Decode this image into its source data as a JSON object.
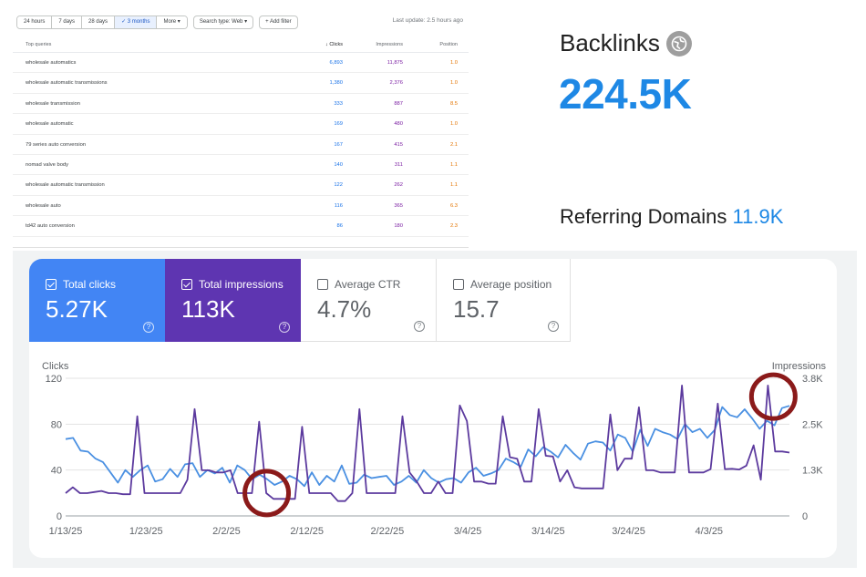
{
  "query_table": {
    "filters": {
      "ranges": [
        "24 hours",
        "7 days",
        "28 days",
        "3 months",
        "More"
      ],
      "active_range": "3 months",
      "search_type": "Search type: Web",
      "add_filter": "Add filter"
    },
    "last_update": "Last update: 2.5 hours ago",
    "headers": {
      "query": "Top queries",
      "clicks": "Clicks",
      "impressions": "Impressions",
      "position": "Position"
    },
    "rows": [
      {
        "query": "wholesale automatics",
        "clicks": "6,893",
        "impressions": "11,875",
        "position": "1.0"
      },
      {
        "query": "wholesale automatic transmissions",
        "clicks": "1,380",
        "impressions": "2,376",
        "position": "1.0"
      },
      {
        "query": "wholesale transmission",
        "clicks": "333",
        "impressions": "887",
        "position": "8.5"
      },
      {
        "query": "wholesale automatic",
        "clicks": "169",
        "impressions": "480",
        "position": "1.0"
      },
      {
        "query": "79 series auto conversion",
        "clicks": "167",
        "impressions": "415",
        "position": "2.1"
      },
      {
        "query": "nomad valve body",
        "clicks": "140",
        "impressions": "311",
        "position": "1.1"
      },
      {
        "query": "wholesale automatic transmission",
        "clicks": "122",
        "impressions": "262",
        "position": "1.1"
      },
      {
        "query": "wholesale auto",
        "clicks": "116",
        "impressions": "365",
        "position": "6.3"
      },
      {
        "query": "td42 auto conversion",
        "clicks": "86",
        "impressions": "180",
        "position": "2.3"
      }
    ]
  },
  "backlinks": {
    "title": "Backlinks",
    "icon": "semrush-globe-icon",
    "value": "224.5K",
    "referring_label": "Referring Domains",
    "referring_value": "11.9K"
  },
  "performance": {
    "metrics": [
      {
        "label": "Total clicks",
        "value": "5.27K",
        "checked": true,
        "color": "#4285f4"
      },
      {
        "label": "Total impressions",
        "value": "113K",
        "checked": true,
        "color": "#5e35b1"
      },
      {
        "label": "Average CTR",
        "value": "4.7%",
        "checked": false
      },
      {
        "label": "Average position",
        "value": "15.7",
        "checked": false
      }
    ],
    "help_glyph": "?"
  },
  "chart_data": {
    "type": "line",
    "left_axis_label": "Clicks",
    "right_axis_label": "Impressions",
    "left_ticks": [
      "120",
      "80",
      "40",
      "0"
    ],
    "left_ylim": [
      0,
      120
    ],
    "right_ticks": [
      "3.8K",
      "2.5K",
      "1.3K",
      "0"
    ],
    "right_ylim": [
      0,
      3800
    ],
    "x_tick_labels": [
      "1/13/25",
      "1/23/25",
      "2/2/25",
      "2/12/25",
      "2/22/25",
      "3/4/25",
      "3/14/25",
      "3/24/25",
      "4/3/25"
    ],
    "x_range": [
      "2025-01-13",
      "2025-04-13"
    ],
    "grid": true,
    "series": [
      {
        "axis": "left",
        "color": "#4a90e2",
        "values": [
          67,
          68,
          57,
          56,
          50,
          47,
          38,
          29,
          40,
          34,
          40,
          44,
          30,
          32,
          41,
          34,
          45,
          46,
          34,
          40,
          37,
          42,
          29,
          44,
          40,
          32,
          36,
          32,
          27,
          30,
          35,
          32,
          26,
          38,
          27,
          35,
          30,
          44,
          28,
          29,
          36,
          33,
          34,
          35,
          27,
          30,
          35,
          29,
          40,
          33,
          29,
          32,
          33,
          29,
          38,
          42,
          35,
          37,
          40,
          50,
          47,
          43,
          58,
          52,
          60,
          56,
          51,
          62,
          55,
          49,
          63,
          65,
          64,
          57,
          71,
          68,
          56,
          75,
          61,
          76,
          73,
          71,
          67,
          80,
          73,
          76,
          68,
          75,
          95,
          88,
          86,
          93,
          85,
          76,
          83,
          79,
          94,
          96
        ]
      },
      {
        "axis": "right",
        "color": "#5c3a9e",
        "values": [
          630,
          790,
          630,
          630,
          660,
          690,
          630,
          630,
          600,
          600,
          2750,
          630,
          630,
          630,
          630,
          630,
          630,
          1000,
          2950,
          1260,
          1260,
          1200,
          1200,
          1260,
          630,
          630,
          630,
          2600,
          630,
          470,
          470,
          470,
          470,
          2460,
          630,
          630,
          630,
          630,
          410,
          410,
          630,
          2950,
          630,
          630,
          630,
          630,
          630,
          2750,
          1200,
          950,
          630,
          630,
          950,
          630,
          630,
          3050,
          2620,
          950,
          950,
          890,
          890,
          2750,
          1620,
          1580,
          950,
          950,
          2950,
          1660,
          1640,
          950,
          1260,
          790,
          760,
          760,
          760,
          760,
          2800,
          1260,
          1580,
          1580,
          3000,
          1260,
          1260,
          1200,
          1200,
          1200,
          3600,
          1200,
          1200,
          1200,
          1290,
          3100,
          1290,
          1300,
          1280,
          1390,
          1950,
          1000,
          3600,
          1780,
          1780,
          1750
        ]
      }
    ],
    "annotations": [
      {
        "shape": "circle",
        "color": "#8b1a1a",
        "center": [
          "2025-02-07",
          20
        ]
      },
      {
        "shape": "circle",
        "color": "#8b1a1a",
        "center": [
          "2025-04-11",
          104
        ]
      }
    ]
  }
}
